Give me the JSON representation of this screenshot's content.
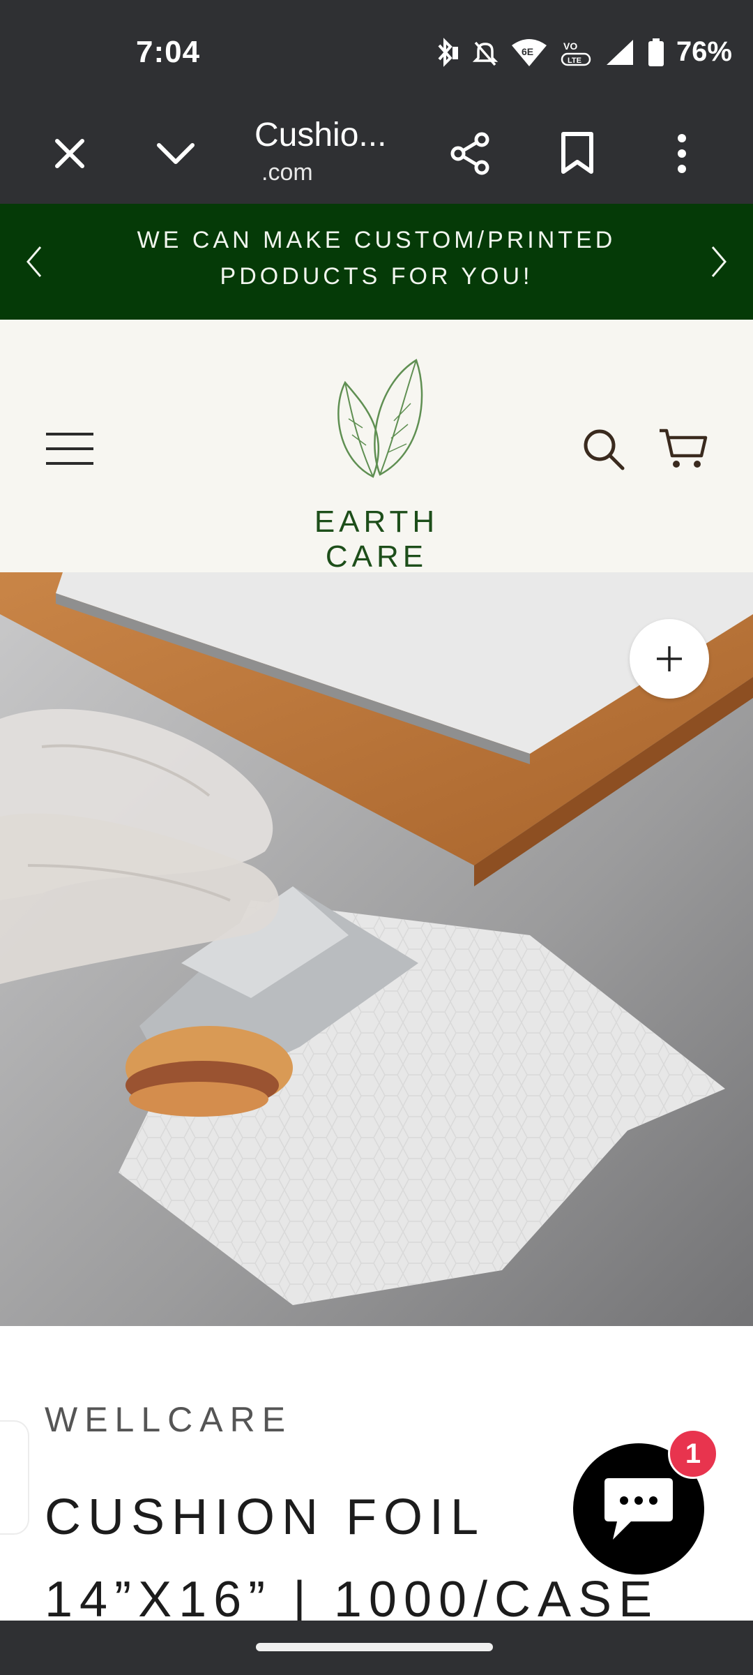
{
  "status_bar": {
    "time": "7:04",
    "battery": "76%",
    "icons": [
      "bluetooth-icon",
      "mute-icon",
      "wifi-6e-icon",
      "volte-icon",
      "signal-icon",
      "battery-icon"
    ]
  },
  "browser": {
    "title": "Cushio...",
    "domain": ".com"
  },
  "promo": {
    "text": "WE CAN MAKE CUSTOM/PRINTED PDODUCTS FOR YOU!"
  },
  "header": {
    "brand": "EARTH CARE",
    "brand_color": "#1d4e1a"
  },
  "product": {
    "vendor": "WELLCARE",
    "title_line1": "CUSHION FOIL",
    "title_line2": "14”X16” | 1000/CASE"
  },
  "chat": {
    "badge_count": "1",
    "badge_color": "#e8344e"
  },
  "colors": {
    "promo_bg": "#053a07",
    "header_bg": "#f7f6f1",
    "system_bar_bg": "#2f3033"
  }
}
